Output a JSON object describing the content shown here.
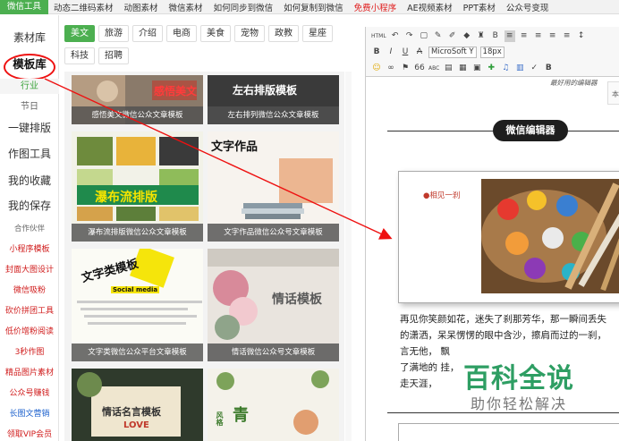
{
  "topnav": {
    "items": [
      "微信工具",
      "动态二维码素材",
      "动图素材",
      "微信素材",
      "如何同步到微信",
      "如何复制到微信",
      "免费小程序",
      "AE视频素材",
      "PPT素材",
      "公众号变现"
    ]
  },
  "sidebar": {
    "items": [
      "素材库",
      "模板库",
      "行业",
      "节日",
      "一键排版",
      "作图工具",
      "我的收藏",
      "我的保存",
      "合作伙伴",
      "小程序模板",
      "封面大图设计",
      "微信吸粉",
      "砍价拼团工具",
      "低价增粉阅读",
      "3秒作图",
      "精品图片素材",
      "公众号赚钱",
      "长图文营销",
      "领取VIP会员"
    ]
  },
  "tags": [
    "美文",
    "旅游",
    "介绍",
    "电商",
    "美食",
    "宠物",
    "政教",
    "星座",
    "科技",
    "招聘"
  ],
  "templates": [
    {
      "caption": "感悟美文微信公众文章模板",
      "thumb_text": "感悟美文"
    },
    {
      "caption": "左右排列微信公众文章模板",
      "thumb_text": "左右排版模板"
    },
    {
      "caption": "瀑布流排版微信公众文章模板",
      "thumb_text": "瀑布流排版"
    },
    {
      "caption": "文字作品微信公众号文章模板",
      "thumb_text": "文字作品"
    },
    {
      "caption": "文字类微信公众平台文章模板",
      "thumb_text": "文字类模板",
      "thumb_sub": "Social media"
    },
    {
      "caption": "情话微信公众号文章模板",
      "thumb_text": "情话模板"
    },
    {
      "caption": "",
      "thumb_text": "情话名言模板",
      "thumb_sub": "LOVE"
    },
    {
      "caption": "",
      "thumb_text": "青",
      "thumb_sub": "风格"
    }
  ],
  "editor": {
    "toolbar_row1": [
      "HTML",
      "↶",
      "↷",
      "▢",
      "✎",
      "✐",
      "◆",
      "♜",
      "B",
      "≡",
      "≡",
      "≡",
      "≡",
      "≡",
      "↕"
    ],
    "toolbar_row2": {
      "bold": "B",
      "italic": "I",
      "underline": "U",
      "strike": "A",
      "font": "MicroSoft Y",
      "size": "18px"
    },
    "toolbar_row3": [
      "☺",
      "∞",
      "⚑",
      "66",
      "ABC",
      "▤",
      "▦",
      "▣",
      "✚",
      "♫",
      "▥",
      "✓",
      "B"
    ],
    "top_note": "最好用的编辑器",
    "side_box": "本",
    "title": "微信编辑器",
    "frame_note": "●相见一刹",
    "body_lines": [
      "再见你笑颜如花，迷失了刹那芳华，那一瞬间丢失",
      "的潇洒，呆呆愣愣的眼中含沙，擦肩而过的一刹，",
      "言无他，                                       飘",
      "了满地的                                     挂，",
      "走天涯，"
    ]
  },
  "watermark": {
    "main": "百科全说",
    "sub": "助你轻松解决"
  }
}
